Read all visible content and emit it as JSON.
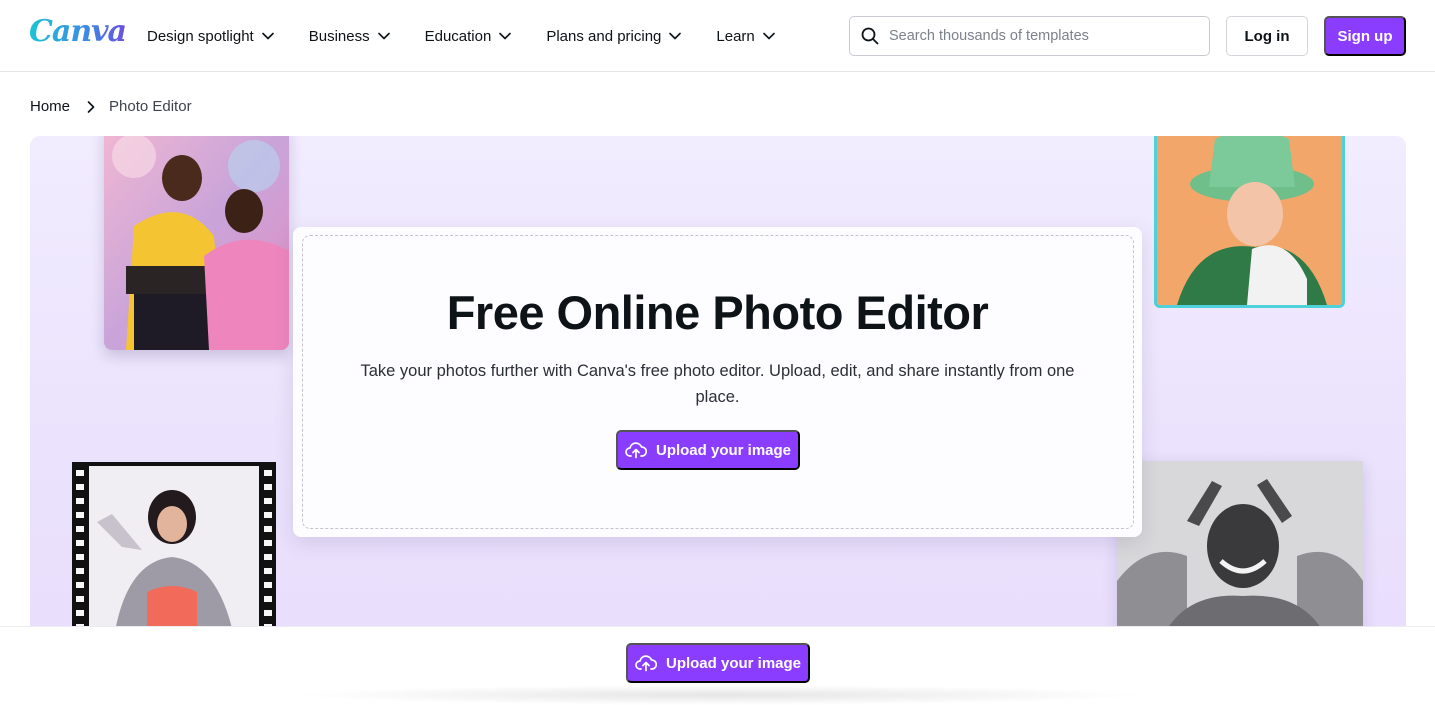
{
  "header": {
    "logo": "Canva",
    "nav": [
      {
        "label": "Design spotlight"
      },
      {
        "label": "Business"
      },
      {
        "label": "Education"
      },
      {
        "label": "Plans and pricing"
      },
      {
        "label": "Learn"
      }
    ],
    "search": {
      "placeholder": "Search thousands of templates",
      "value": ""
    },
    "login_label": "Log in",
    "signup_label": "Sign up"
  },
  "breadcrumb": {
    "home": "Home",
    "current": "Photo Editor"
  },
  "hero": {
    "title": "Free Online Photo Editor",
    "subtitle": "Take your photos further with Canva's free photo editor. Upload, edit, and share instantly from one place.",
    "upload_label": "Upload your image"
  },
  "sticky_bar": {
    "upload_label": "Upload your image"
  },
  "colors": {
    "brand_purple": "#8b3dff",
    "hero_background": "#ede5fd",
    "photo_frame_teal": "#4fd1d9",
    "text_primary": "#0e1318"
  },
  "icons": [
    "search-icon",
    "chevron-down-icon",
    "chevron-right-icon",
    "cloud-upload-icon"
  ]
}
